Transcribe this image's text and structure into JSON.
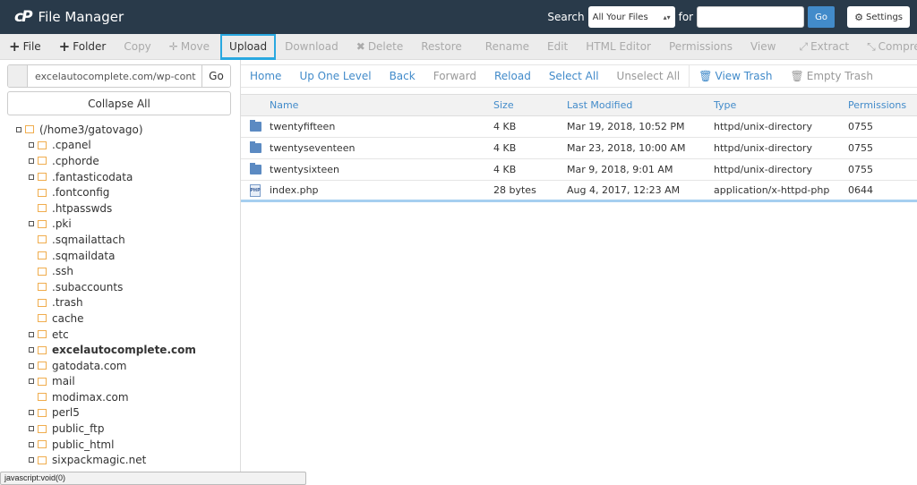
{
  "header": {
    "logo": "cP",
    "title": "File Manager",
    "search_label": "Search",
    "scope_value": "All Your Files",
    "for_label": "for",
    "search_value": "",
    "go_label": "Go",
    "settings_label": "Settings"
  },
  "toolbar": {
    "items": [
      {
        "label": "File",
        "icon": "plus",
        "enabled": true
      },
      {
        "label": "Folder",
        "icon": "plus",
        "enabled": true
      },
      {
        "label": "Copy",
        "enabled": false
      },
      {
        "label": "Move",
        "icon": "move",
        "enabled": false
      },
      {
        "label": "Upload",
        "enabled": true,
        "highlighted": true
      },
      {
        "label": "Download",
        "enabled": false
      },
      {
        "label": "Delete",
        "icon": "x",
        "enabled": false
      },
      {
        "label": "Restore",
        "enabled": false
      },
      {
        "label": "Rename",
        "enabled": false
      },
      {
        "label": "Edit",
        "enabled": false
      },
      {
        "label": "HTML Editor",
        "enabled": false
      },
      {
        "label": "Permissions",
        "enabled": false
      },
      {
        "label": "View",
        "enabled": false
      },
      {
        "label": "Extract",
        "icon": "expand",
        "enabled": false
      },
      {
        "label": "Compress",
        "icon": "compress",
        "enabled": false
      }
    ]
  },
  "left": {
    "path_value": "excelautocomplete.com/wp-cont",
    "go_label": "Go",
    "collapse_label": "Collapse All",
    "tree": [
      {
        "label": "(/home3/gatovago)",
        "level": 0,
        "expandable": true
      },
      {
        "label": ".cpanel",
        "level": 1,
        "expandable": true
      },
      {
        "label": ".cphorde",
        "level": 1,
        "expandable": true
      },
      {
        "label": ".fantasticodata",
        "level": 1,
        "expandable": true
      },
      {
        "label": ".fontconfig",
        "level": 1,
        "expandable": false
      },
      {
        "label": ".htpasswds",
        "level": 1,
        "expandable": false
      },
      {
        "label": ".pki",
        "level": 1,
        "expandable": true
      },
      {
        "label": ".sqmailattach",
        "level": 1,
        "expandable": false
      },
      {
        "label": ".sqmaildata",
        "level": 1,
        "expandable": false
      },
      {
        "label": ".ssh",
        "level": 1,
        "expandable": false
      },
      {
        "label": ".subaccounts",
        "level": 1,
        "expandable": false
      },
      {
        "label": ".trash",
        "level": 1,
        "expandable": false
      },
      {
        "label": "cache",
        "level": 1,
        "expandable": false
      },
      {
        "label": "etc",
        "level": 1,
        "expandable": true
      },
      {
        "label": "excelautocomplete.com",
        "level": 1,
        "expandable": true,
        "bold": true
      },
      {
        "label": "gatodata.com",
        "level": 1,
        "expandable": true
      },
      {
        "label": "mail",
        "level": 1,
        "expandable": true
      },
      {
        "label": "modimax.com",
        "level": 1,
        "expandable": false
      },
      {
        "label": "perl5",
        "level": 1,
        "expandable": true
      },
      {
        "label": "public_ftp",
        "level": 1,
        "expandable": true
      },
      {
        "label": "public_html",
        "level": 1,
        "expandable": true
      },
      {
        "label": "sixpackmagic.net",
        "level": 1,
        "expandable": true
      }
    ]
  },
  "nav": {
    "items": [
      {
        "label": "Home",
        "enabled": true
      },
      {
        "label": "Up One Level",
        "enabled": true
      },
      {
        "label": "Back",
        "enabled": true
      },
      {
        "label": "Forward",
        "enabled": false
      },
      {
        "label": "Reload",
        "enabled": true
      },
      {
        "label": "Select All",
        "enabled": true
      },
      {
        "label": "Unselect All",
        "enabled": false
      },
      {
        "label": "View Trash",
        "enabled": true,
        "icon": "trash"
      },
      {
        "label": "Empty Trash",
        "enabled": false,
        "icon": "trash"
      }
    ]
  },
  "table": {
    "columns": [
      "Name",
      "Size",
      "Last Modified",
      "Type",
      "Permissions"
    ],
    "rows": [
      {
        "icon": "folder",
        "name": "twentyfifteen",
        "size": "4 KB",
        "modified": "Mar 19, 2018, 10:52 PM",
        "type": "httpd/unix-directory",
        "perms": "0755"
      },
      {
        "icon": "folder",
        "name": "twentyseventeen",
        "size": "4 KB",
        "modified": "Mar 23, 2018, 10:00 AM",
        "type": "httpd/unix-directory",
        "perms": "0755"
      },
      {
        "icon": "folder",
        "name": "twentysixteen",
        "size": "4 KB",
        "modified": "Mar 9, 2018, 9:01 AM",
        "type": "httpd/unix-directory",
        "perms": "0755"
      },
      {
        "icon": "php",
        "name": "index.php",
        "size": "28 bytes",
        "modified": "Aug 4, 2017, 12:23 AM",
        "type": "application/x-httpd-php",
        "perms": "0644"
      }
    ]
  },
  "statusbar": {
    "text": "javascript:void(0)"
  },
  "colors": {
    "header_bg": "#293a4a",
    "accent": "#428bca",
    "folder_orange": "#f0ad4e",
    "upload_highlight": "#29a8e0"
  }
}
